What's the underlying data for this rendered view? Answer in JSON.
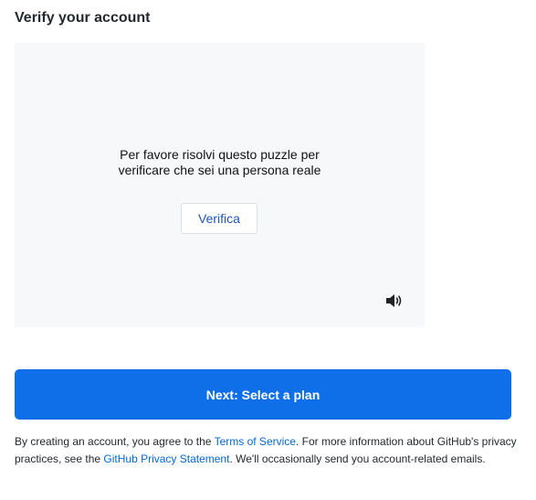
{
  "header": {
    "title": "Verify your account"
  },
  "captcha": {
    "line1": "Per favore risolvi questo puzzle per",
    "line2": "verificare che sei una persona reale",
    "verify_label": "Verifica",
    "audio_icon": "speaker-volume-icon"
  },
  "actions": {
    "next_label": "Next: Select a plan",
    "primary_color": "#0f6fe8"
  },
  "legal": {
    "text1": "By creating an account, you agree to the ",
    "terms_link": "Terms of Service",
    "text2": ". For more information about GitHub's privacy practices, see the ",
    "privacy_link": "GitHub Privacy Statement",
    "text3": ". We'll occasionally send you account-related emails.",
    "link_color": "#0366d6"
  }
}
